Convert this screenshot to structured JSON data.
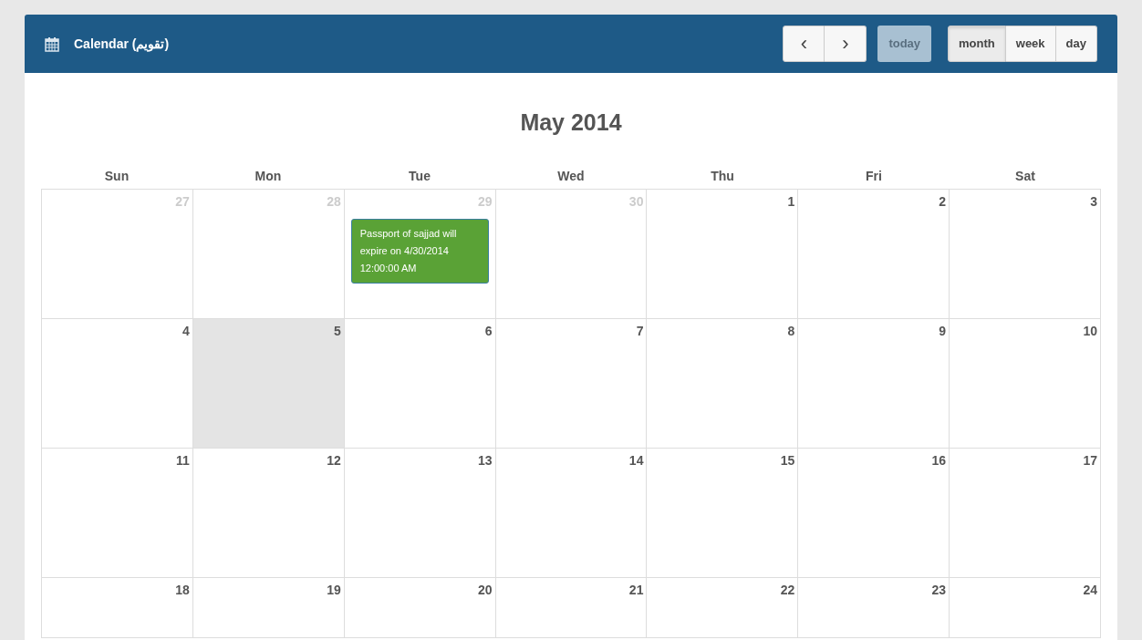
{
  "header": {
    "title": "Calendar (تقويم)",
    "nav": [
      "‹",
      "›"
    ],
    "today": {
      "label": "today",
      "disabled": true
    },
    "views": [
      {
        "label": "month",
        "selected": true
      },
      {
        "label": "week",
        "selected": false
      },
      {
        "label": "day",
        "selected": false
      }
    ]
  },
  "month_title": "May 2014",
  "weekdays": [
    "Sun",
    "Mon",
    "Tue",
    "Wed",
    "Thu",
    "Fri",
    "Sat"
  ],
  "weeks": [
    [
      {
        "day": "27",
        "other_month": true,
        "today": false
      },
      {
        "day": "28",
        "other_month": true,
        "today": false
      },
      {
        "day": "29",
        "other_month": true,
        "today": false,
        "events": [
          {
            "text": "Passport of sajjad will expire on 4/30/2014 12:00:00 AM",
            "color": "#5aa236"
          }
        ]
      },
      {
        "day": "30",
        "other_month": true,
        "today": false
      },
      {
        "day": "1",
        "other_month": false,
        "today": false
      },
      {
        "day": "2",
        "other_month": false,
        "today": false
      },
      {
        "day": "3",
        "other_month": false,
        "today": false
      }
    ],
    [
      {
        "day": "4",
        "other_month": false,
        "today": false
      },
      {
        "day": "5",
        "other_month": false,
        "today": true
      },
      {
        "day": "6",
        "other_month": false,
        "today": false
      },
      {
        "day": "7",
        "other_month": false,
        "today": false
      },
      {
        "day": "8",
        "other_month": false,
        "today": false
      },
      {
        "day": "9",
        "other_month": false,
        "today": false
      },
      {
        "day": "10",
        "other_month": false,
        "today": false
      }
    ],
    [
      {
        "day": "11",
        "other_month": false,
        "today": false
      },
      {
        "day": "12",
        "other_month": false,
        "today": false
      },
      {
        "day": "13",
        "other_month": false,
        "today": false
      },
      {
        "day": "14",
        "other_month": false,
        "today": false
      },
      {
        "day": "15",
        "other_month": false,
        "today": false
      },
      {
        "day": "16",
        "other_month": false,
        "today": false
      },
      {
        "day": "17",
        "other_month": false,
        "today": false
      }
    ],
    [
      {
        "day": "18",
        "other_month": false,
        "today": false
      },
      {
        "day": "19",
        "other_month": false,
        "today": false
      },
      {
        "day": "20",
        "other_month": false,
        "today": false
      },
      {
        "day": "21",
        "other_month": false,
        "today": false
      },
      {
        "day": "22",
        "other_month": false,
        "today": false
      },
      {
        "day": "23",
        "other_month": false,
        "today": false
      },
      {
        "day": "24",
        "other_month": false,
        "today": false
      }
    ]
  ]
}
